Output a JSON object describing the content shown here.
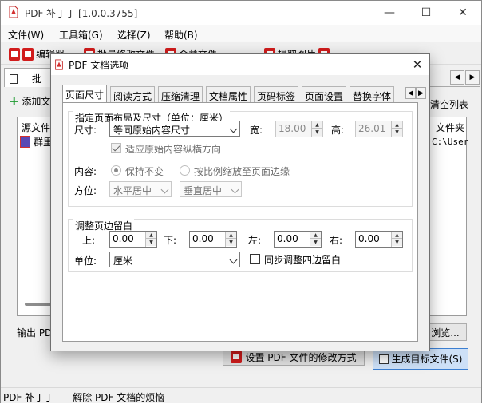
{
  "main": {
    "title": "PDF 补丁丁 [1.0.0.3755]",
    "window_controls": [
      "—",
      "☐",
      "✕"
    ],
    "menu": [
      "文件(W)",
      "工具箱(G)",
      "选择(Z)",
      "帮助(B)"
    ],
    "toolbar": [
      "编辑器",
      "批量修改文件",
      "合并文件",
      "提取图片"
    ],
    "tab": "批",
    "add_button": "添加文",
    "clear_list": "清空列表",
    "list_columns": {
      "source": "源文件",
      "folder": "文件夹"
    },
    "list_row": {
      "name": "群里",
      "path": "C:\\User"
    },
    "output_label": "输出 PDF",
    "browse_label": "浏览...",
    "modify_label": "设置 PDF 文件的修改方式",
    "generate_label": "生成目标文件(S)",
    "status": "PDF 补丁丁——解除 PDF 文档的烦恼"
  },
  "dialog": {
    "title": "PDF 文档选项",
    "close": "✕",
    "tabs": [
      "页面尺寸",
      "阅读方式",
      "压缩清理",
      "文档属性",
      "页码标签",
      "页面设置",
      "替换字体"
    ],
    "active_tab": "页面尺寸",
    "size_group": {
      "legend": "指定页面布局及尺寸（单位：厘米）",
      "size_label": "尺寸:",
      "size_value": "等同原始内容尺寸",
      "width_label": "宽:",
      "width_value": "18.00",
      "height_label": "高:",
      "height_value": "26.01",
      "orientation_label": "适应原始内容纵横方向",
      "orientation_checked": true,
      "content_label": "内容:",
      "keep_label": "保持不变",
      "scale_label": "按比例缩放至页面边缘",
      "align_label": "方位:",
      "halign": "水平居中",
      "valign": "垂直居中"
    },
    "margin_group": {
      "legend": "调整页边留白",
      "top_label": "上:",
      "top_value": "0.00",
      "bottom_label": "下:",
      "bottom_value": "0.00",
      "left_label": "左:",
      "left_value": "0.00",
      "right_label": "右:",
      "right_value": "0.00",
      "unit_label": "单位:",
      "unit_value": "厘米",
      "sync_label": "同步调整四边留白"
    }
  }
}
